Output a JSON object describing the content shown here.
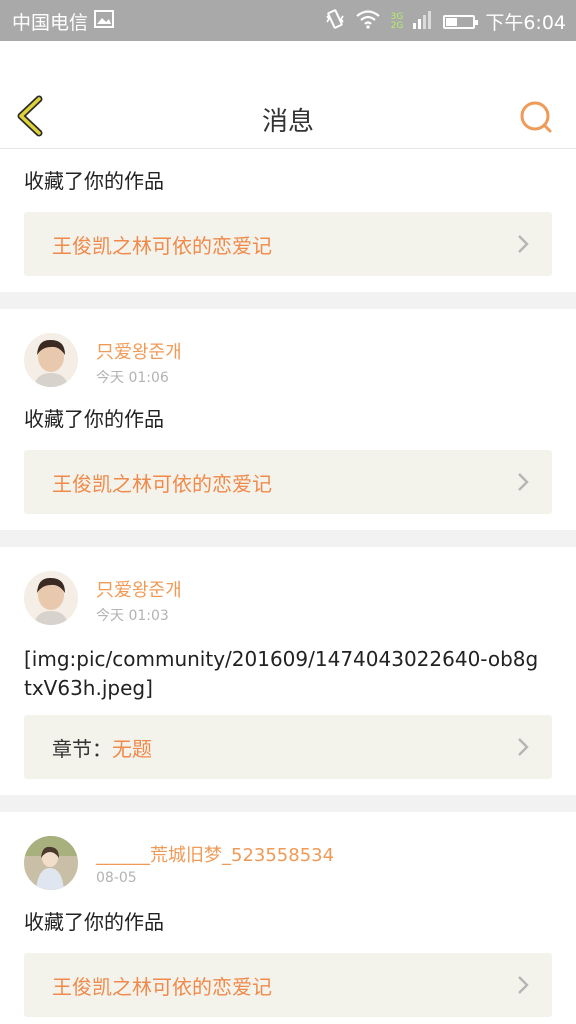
{
  "status_bar": {
    "carrier": "中国电信",
    "network_top": "3G",
    "network_bottom": "2G",
    "time": "下午6:04",
    "battery_level": 0.45
  },
  "header": {
    "title": "消息"
  },
  "notifications": [
    {
      "message": "收藏了你的作品",
      "ref": "王俊凯之林可依的恋爱记"
    },
    {
      "username": "只爱왕준개",
      "time": "今天 01:06",
      "message": "收藏了你的作品",
      "ref": "王俊凯之林可依的恋爱记"
    },
    {
      "username": "只爱왕준개",
      "time": "今天 01:03",
      "message": "[img:pic/community/201609/1474043022640-ob8gtxV63h.jpeg]",
      "ref_label": "章节：",
      "ref": "无题"
    },
    {
      "username": "______荒城旧梦_523558534",
      "time": "08-05",
      "message": "收藏了你的作品",
      "ref": "王俊凯之林可依的恋爱记"
    }
  ],
  "colors": {
    "accent": "#f09a57",
    "ref_text": "#f08a4b",
    "ref_bg": "#f3f3ec",
    "back_arrow": "#e0d33a"
  }
}
